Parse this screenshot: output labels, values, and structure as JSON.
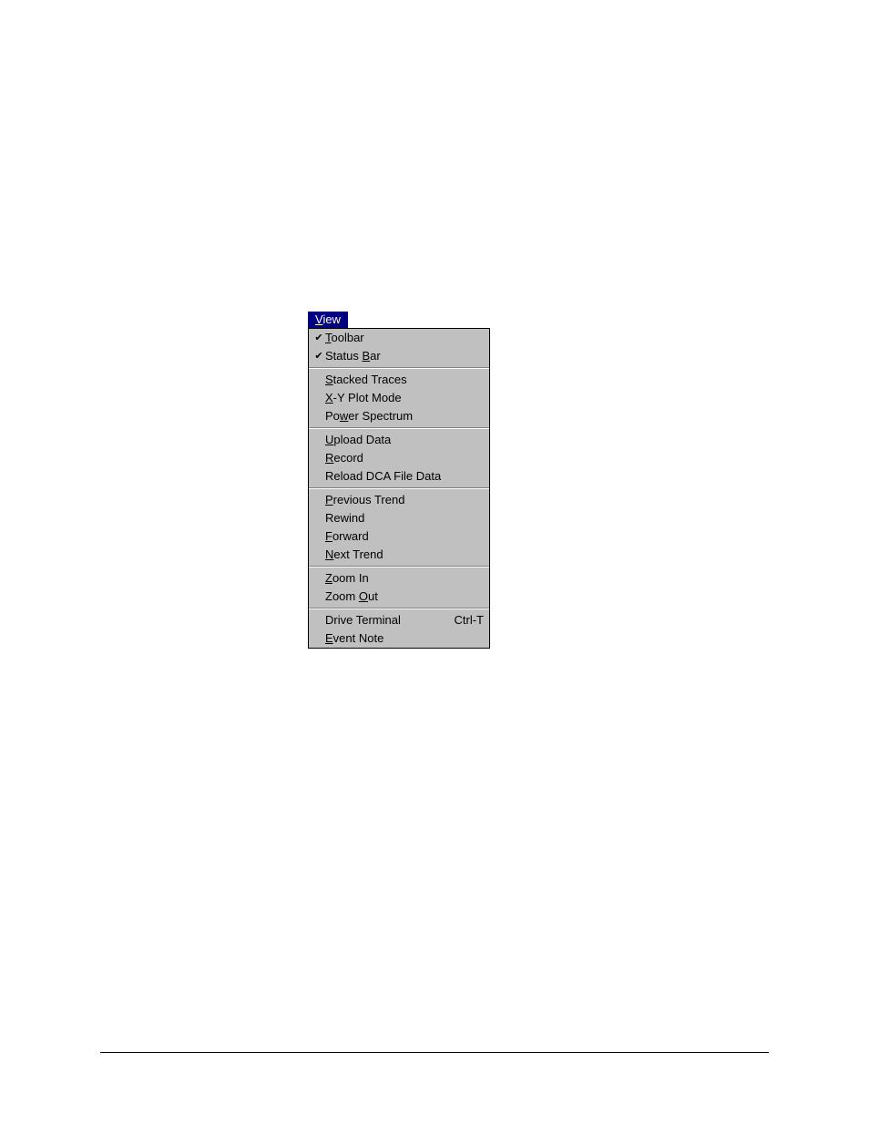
{
  "menu": {
    "title": {
      "pre": "",
      "u": "V",
      "post": "iew"
    },
    "groups": [
      [
        {
          "id": "toolbar",
          "checked": true,
          "pre": "",
          "u": "T",
          "post": "oolbar"
        },
        {
          "id": "status-bar",
          "checked": true,
          "pre": "Status ",
          "u": "B",
          "post": "ar"
        }
      ],
      [
        {
          "id": "stacked-traces",
          "checked": false,
          "pre": "",
          "u": "S",
          "post": "tacked Traces"
        },
        {
          "id": "xy-plot-mode",
          "checked": false,
          "pre": "",
          "u": "X",
          "post": "-Y Plot Mode"
        },
        {
          "id": "power-spectrum",
          "checked": false,
          "pre": "Po",
          "u": "w",
          "post": "er Spectrum"
        }
      ],
      [
        {
          "id": "upload-data",
          "checked": false,
          "pre": "",
          "u": "U",
          "post": "pload Data"
        },
        {
          "id": "record",
          "checked": false,
          "pre": "",
          "u": "R",
          "post": "ecord"
        },
        {
          "id": "reload-dca",
          "checked": false,
          "pre": "Reload DCA File Data",
          "u": "",
          "post": ""
        }
      ],
      [
        {
          "id": "previous-trend",
          "checked": false,
          "pre": "",
          "u": "P",
          "post": "revious Trend"
        },
        {
          "id": "rewind",
          "checked": false,
          "pre": "Rewind",
          "u": "",
          "post": ""
        },
        {
          "id": "forward",
          "checked": false,
          "pre": "",
          "u": "F",
          "post": "orward"
        },
        {
          "id": "next-trend",
          "checked": false,
          "pre": "",
          "u": "N",
          "post": "ext Trend"
        }
      ],
      [
        {
          "id": "zoom-in",
          "checked": false,
          "pre": "",
          "u": "Z",
          "post": "oom In"
        },
        {
          "id": "zoom-out",
          "checked": false,
          "pre": "Zoom ",
          "u": "O",
          "post": "ut"
        }
      ],
      [
        {
          "id": "drive-terminal",
          "checked": false,
          "pre": "Drive Terminal",
          "u": "",
          "post": "",
          "shortcut": "Ctrl-T"
        },
        {
          "id": "event-note",
          "checked": false,
          "pre": "",
          "u": "E",
          "post": "vent Note"
        }
      ]
    ],
    "checkmark": "✔"
  }
}
